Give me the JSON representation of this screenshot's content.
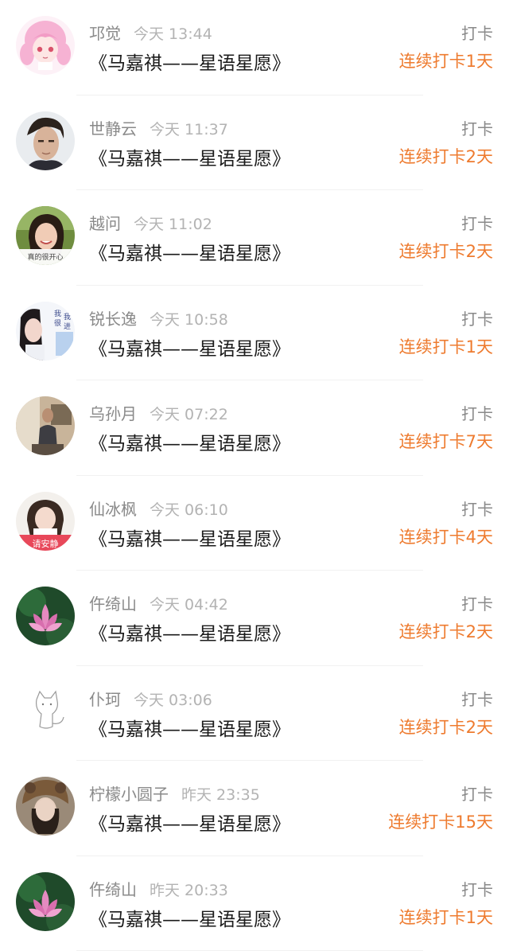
{
  "rows": [
    {
      "name": "邛觉",
      "time": "今天 13:44",
      "title": "《马嘉祺——星语星愿》",
      "action": "打卡",
      "streak": "连续打卡1天",
      "avatar": "anime-girl"
    },
    {
      "name": "世静云",
      "time": "今天 11:37",
      "title": "《马嘉祺——星语星愿》",
      "action": "打卡",
      "streak": "连续打卡2天",
      "avatar": "man-portrait"
    },
    {
      "name": "越问",
      "time": "今天 11:02",
      "title": "《马嘉祺——星语星愿》",
      "action": "打卡",
      "streak": "连续打卡2天",
      "avatar": "girl-smiling",
      "avatar_text": "真的很开心"
    },
    {
      "name": "锐长逸",
      "time": "今天 10:58",
      "title": "《马嘉祺——星语星愿》",
      "action": "打卡",
      "streak": "连续打卡1天",
      "avatar": "girl-text"
    },
    {
      "name": "乌孙月",
      "time": "今天 07:22",
      "title": "《马嘉祺——星语星愿》",
      "action": "打卡",
      "streak": "连续打卡7天",
      "avatar": "man-room"
    },
    {
      "name": "仙冰枫",
      "time": "今天 06:10",
      "title": "《马嘉祺——星语星愿》",
      "action": "打卡",
      "streak": "连续打卡4天",
      "avatar": "girl-pink",
      "avatar_text": "请安静"
    },
    {
      "name": "仵绮山",
      "time": "今天 04:42",
      "title": "《马嘉祺——星语星愿》",
      "action": "打卡",
      "streak": "连续打卡2天",
      "avatar": "lotus"
    },
    {
      "name": "仆珂",
      "time": "今天 03:06",
      "title": "《马嘉祺——星语星愿》",
      "action": "打卡",
      "streak": "连续打卡2天",
      "avatar": "cat-sketch"
    },
    {
      "name": "柠檬小圆子",
      "time": "昨天 23:35",
      "title": "《马嘉祺——星语星愿》",
      "action": "打卡",
      "streak": "连续打卡15天",
      "avatar": "girl-hat"
    },
    {
      "name": "仵绮山",
      "time": "昨天 20:33",
      "title": "《马嘉祺——星语星愿》",
      "action": "打卡",
      "streak": "连续打卡1天",
      "avatar": "lotus"
    }
  ],
  "colors": {
    "streak": "#ee7b2f",
    "name": "#8a8a8a",
    "time": "#b3b3b3",
    "title": "#1a1a1a"
  }
}
